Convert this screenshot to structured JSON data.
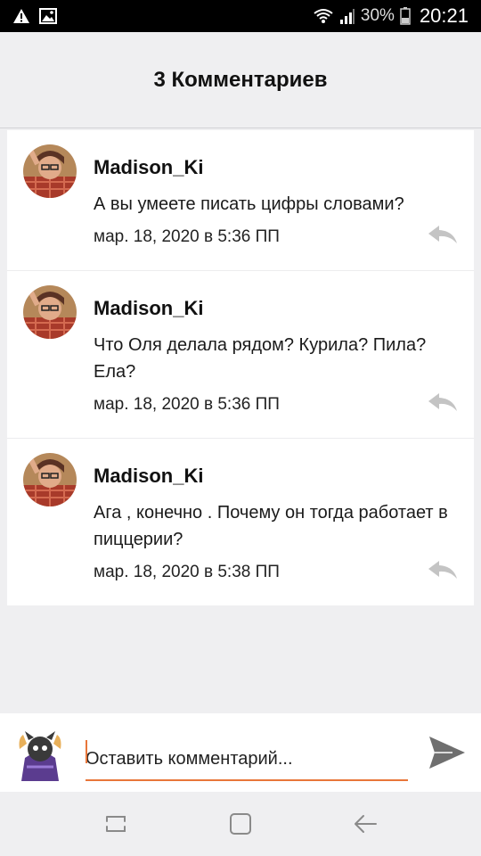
{
  "status_bar": {
    "battery_percent": "30%",
    "time": "20:21",
    "left_icons": [
      "warning-icon",
      "image-icon"
    ],
    "right_icons": [
      "wifi-icon",
      "signal-icon",
      "battery-icon"
    ]
  },
  "header": {
    "title": "3 Комментариев"
  },
  "comments": [
    {
      "author": "Madison_Ki",
      "text": "А вы умеете писать цифры словами?",
      "date": "мар. 18, 2020 в 5:36 ПП"
    },
    {
      "author": "Madison_Ki",
      "text": "Что Оля делала рядом? Курила? Пила? Ела?",
      "date": "мар. 18, 2020 в 5:36 ПП"
    },
    {
      "author": "Madison_Ki",
      "text": "Ага , конечно . Почему он тогда работает в пиццерии?",
      "date": "мар. 18, 2020 в 5:38 ПП"
    }
  ],
  "input": {
    "placeholder": "Оставить комментарий..."
  },
  "colors": {
    "accent": "#e8763a",
    "background": "#efeff1"
  },
  "nav_icons": [
    "recents-icon",
    "home-icon",
    "back-icon"
  ]
}
